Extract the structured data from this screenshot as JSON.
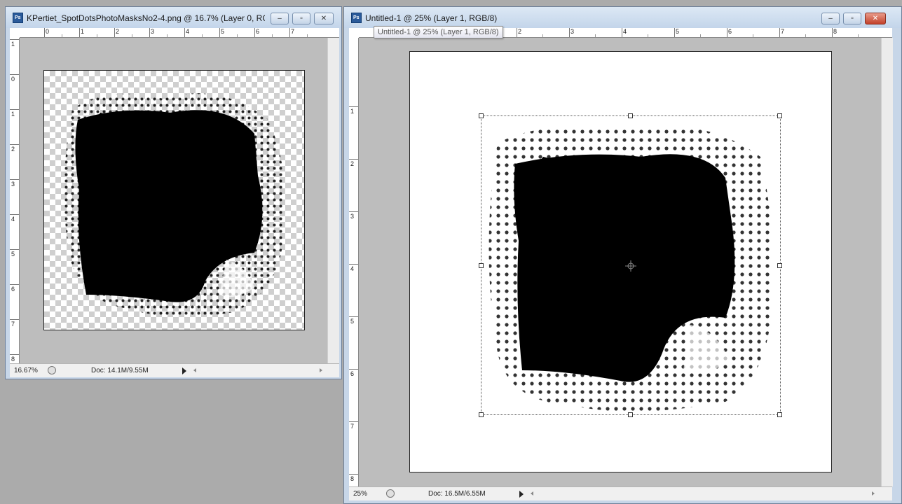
{
  "left_window": {
    "title": "KPertiet_SpotDotsPhotoMasksNo2-4.png @ 16.7% (Layer 0, RG...",
    "ruler_top": [
      "0",
      "1",
      "2",
      "3",
      "4",
      "5",
      "6",
      "7"
    ],
    "ruler_left": [
      "1",
      "0",
      "1",
      "2",
      "3",
      "4",
      "5",
      "6",
      "7",
      "8"
    ],
    "status": {
      "zoom": "16.67%",
      "doc": "Doc: 14.1M/9.55M"
    }
  },
  "right_window": {
    "title": "Untitled-1 @ 25% (Layer 1, RGB/8)",
    "tooltip": "Untitled-1 @ 25% (Layer 1, RGB/8)",
    "ruler_top": [
      "2",
      "3",
      "4",
      "5",
      "6",
      "7",
      "8"
    ],
    "ruler_left": [
      "1",
      "2",
      "3",
      "4",
      "5",
      "6",
      "7",
      "8"
    ],
    "status": {
      "zoom": "25%",
      "doc": "Doc: 16.5M/6.55M"
    }
  },
  "window_controls": {
    "minimize": "–",
    "maximize": "▫",
    "close": "✕"
  },
  "icons": [
    "photoshop-doc-icon",
    "minimize-icon",
    "maximize-icon",
    "close-icon",
    "status-info-icon",
    "status-arrow-icon",
    "center-crosshair-icon"
  ]
}
